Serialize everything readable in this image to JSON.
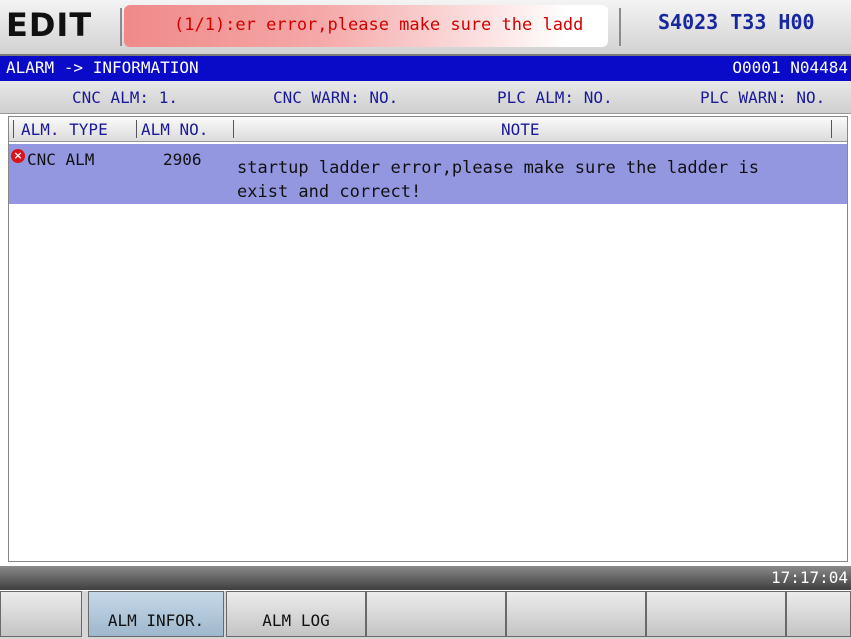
{
  "topbar": {
    "mode": "EDIT",
    "alarm_message": "(1/1):er error,please make sure the ladd",
    "spindle_tool_h": "S4023 T33 H00"
  },
  "titlebar": {
    "path": "ALARM -> INFORMATION",
    "program": "O0001 N04484"
  },
  "summary": {
    "cnc_alm": "CNC ALM: 1.",
    "cnc_warn": "CNC WARN: NO.",
    "plc_alm": "PLC ALM: NO.",
    "plc_warn": "PLC WARN: NO."
  },
  "table": {
    "columns": [
      "ALM. TYPE",
      "ALM NO.",
      "NOTE"
    ],
    "rows": [
      {
        "type": "CNC ALM",
        "number": "2906",
        "note": "startup ladder error,please make sure the ladder is exist and correct!"
      }
    ]
  },
  "status": {
    "time": "17:17:04"
  },
  "softkeys": [
    "",
    "ALM INFOR.",
    "ALM LOG",
    "",
    "",
    "",
    ""
  ],
  "active_softkey": "ALM INFOR.",
  "colors": {
    "title_bar": "#0a0ac9",
    "selected_row": "#9297e0",
    "alarm_text": "#d40000",
    "status_text": "#17279e"
  },
  "icons": {
    "row_status": "error-icon"
  }
}
